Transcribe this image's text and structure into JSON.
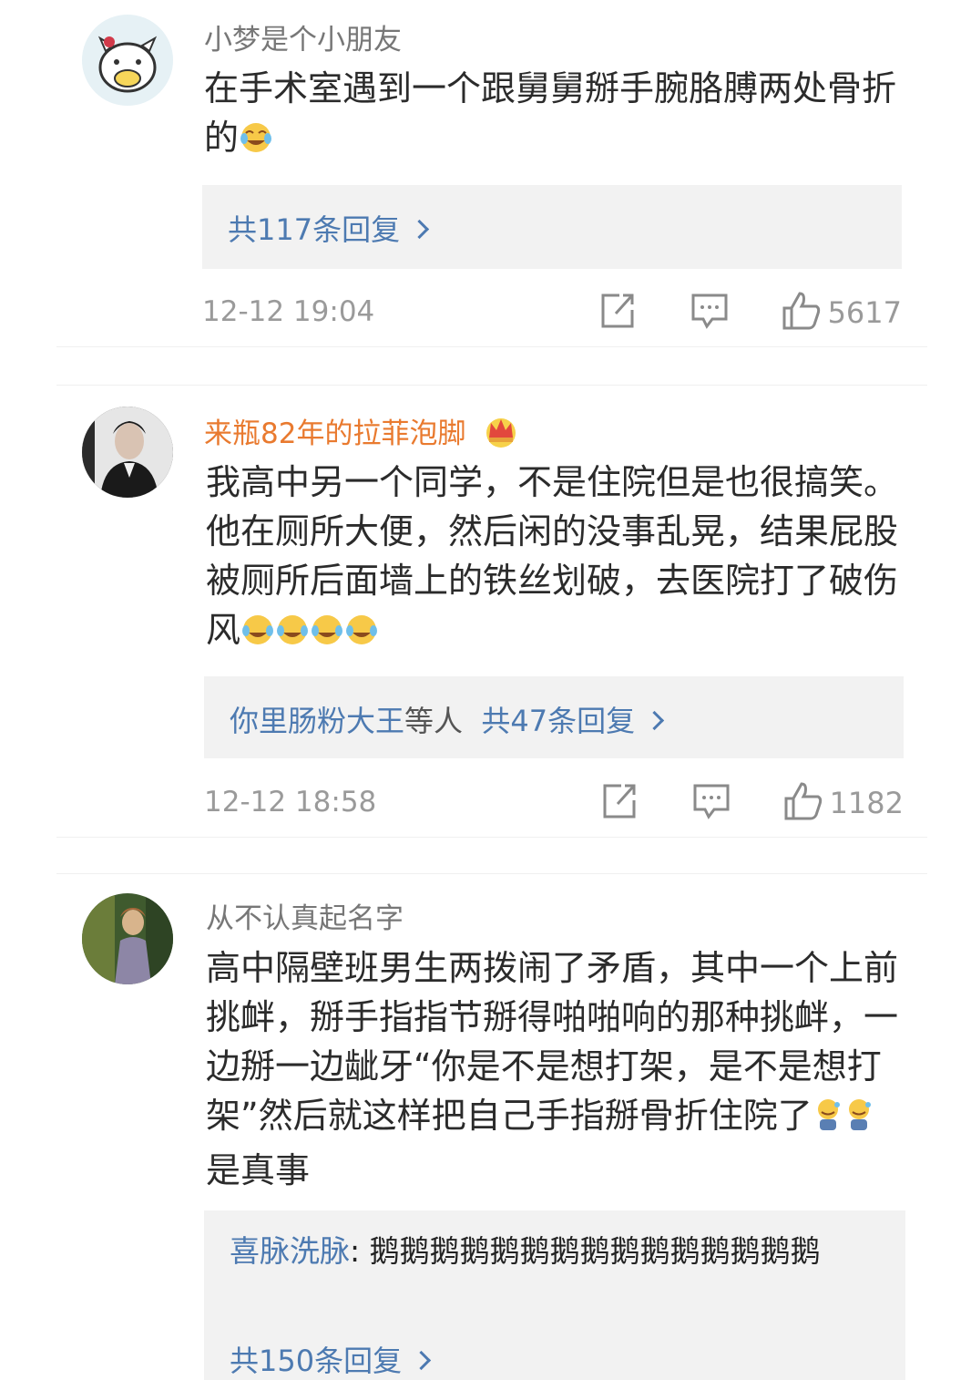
{
  "comments": [
    {
      "username": "小梦是个小朋友",
      "text": "在手术室遇到一个跟舅舅掰手腕胳膊两处骨折的",
      "replies_label": "共117条回复",
      "time": "12-12 19:04",
      "likes": "5617"
    },
    {
      "username": "来瓶82年的拉菲泡脚",
      "text": "我高中另一个同学，不是住院但是也很搞笑。他在厕所大便，然后闲的没事乱晃，结果屁股被厕所后面墙上的铁丝划破，去医院打了破伤风",
      "reply_users": "你里肠粉大王",
      "reply_others": "等人",
      "replies_label": "共47条回复",
      "time": "12-12 18:58",
      "likes": "1182"
    },
    {
      "username": "从不认真起名字",
      "text": "高中隔壁班男生两拨闹了矛盾，其中一个上前挑衅，掰手指指节掰得啪啪响的那种挑衅，一边掰一边龇牙“你是不是想打架，是不是想打架”然后就这样把自己手指掰骨折住院了",
      "text_tail": "是真事",
      "reply_snippet_user": "喜脉洗脉",
      "reply_snippet_text": ": 鹅鹅鹅鹅鹅鹅鹅鹅鹅鹅鹅鹅鹅鹅鹅",
      "replies_label": "共150条回复"
    }
  ],
  "icons": [
    "share-icon",
    "comment-icon",
    "like-icon",
    "laugh-cry-emoji",
    "crown-icon",
    "sweat-emoji"
  ],
  "colors": {
    "link": "#4d7ab1",
    "vip_name": "#e97a2f",
    "reply_bg": "#f2f2f2"
  }
}
